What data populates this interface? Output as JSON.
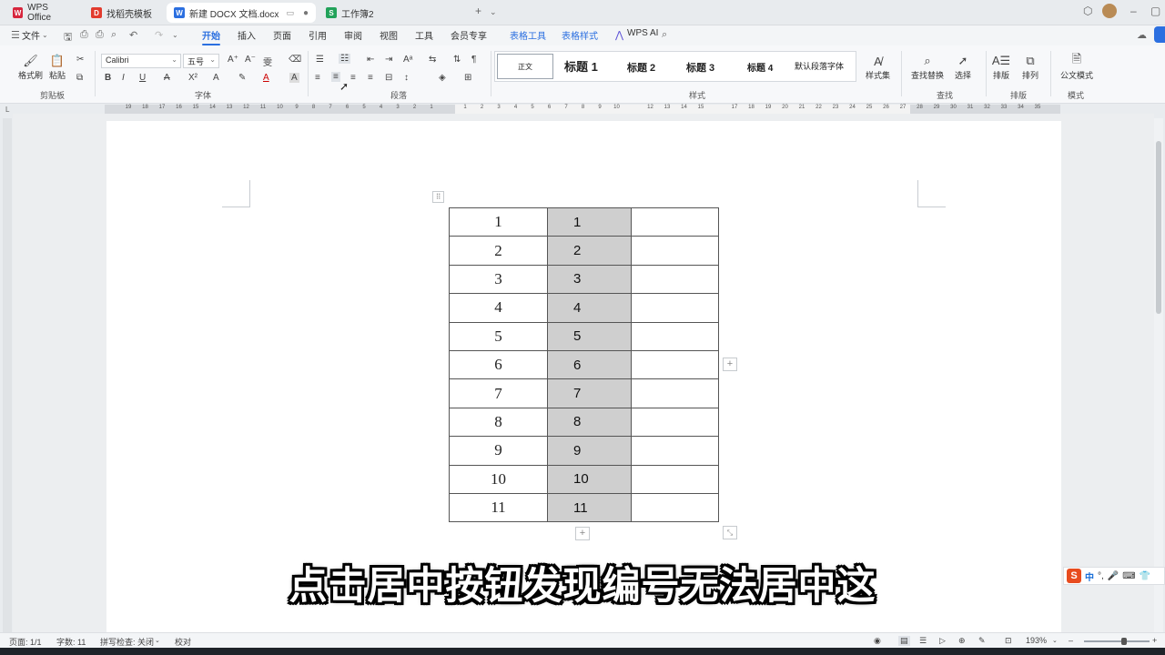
{
  "tabs": [
    {
      "label": "WPS Office",
      "icon": "wps-logo-icon",
      "color": "#d7263d"
    },
    {
      "label": "找稻壳模板",
      "icon": "docer-icon",
      "color": "#e23b2e"
    },
    {
      "label": "新建 DOCX 文档.docx",
      "icon": "word-doc-icon",
      "color": "#2b6fe0"
    },
    {
      "label": "工作簿2",
      "icon": "sheet-icon",
      "color": "#22a25a"
    }
  ],
  "menu": {
    "file": "文件",
    "items": [
      "开始",
      "插入",
      "页面",
      "引用",
      "审阅",
      "视图",
      "工具",
      "会员专享"
    ],
    "context": [
      "表格工具",
      "表格样式"
    ],
    "ai": "WPS AI"
  },
  "ribbon": {
    "clipboard": {
      "format_painter": "格式刷",
      "paste": "粘贴",
      "group": "剪贴板"
    },
    "font": {
      "name": "Calibri",
      "size": "五号",
      "group": "字体"
    },
    "paragraph": {
      "group": "段落"
    },
    "styles": {
      "items": [
        "正文",
        "标题 1",
        "标题 2",
        "标题 3",
        "标题 4",
        "默认段落字体"
      ],
      "set": "样式集",
      "group": "样式"
    },
    "find": {
      "find_replace": "查找替换",
      "select": "选择",
      "group": "查找"
    },
    "arrange": {
      "layout": "排版",
      "order": "排列",
      "group": "排版"
    },
    "mode": {
      "official": "公文模式",
      "group": "模式"
    }
  },
  "ruler": {
    "left_numbers": [
      "19",
      "18",
      "17",
      "16",
      "15",
      "14",
      "13",
      "12",
      "11",
      "10",
      "9",
      "8",
      "7",
      "6",
      "5",
      "4",
      "3",
      "2",
      "1"
    ],
    "right_numbers": [
      "1",
      "2",
      "3",
      "4",
      "5",
      "6",
      "7",
      "8",
      "9",
      "10",
      "12",
      "13",
      "14",
      "15",
      "17",
      "18",
      "19",
      "20",
      "21",
      "22",
      "23",
      "24",
      "25",
      "26",
      "27",
      "28",
      "29",
      "30",
      "31",
      "32",
      "33",
      "34",
      "35"
    ]
  },
  "table": {
    "rows": [
      [
        "1",
        "1",
        ""
      ],
      [
        "2",
        "2",
        ""
      ],
      [
        "3",
        "3",
        ""
      ],
      [
        "4",
        "4",
        ""
      ],
      [
        "5",
        "5",
        ""
      ],
      [
        "6",
        "6",
        ""
      ],
      [
        "7",
        "7",
        ""
      ],
      [
        "8",
        "8",
        ""
      ],
      [
        "9",
        "9",
        ""
      ],
      [
        "10",
        "10",
        ""
      ],
      [
        "11",
        "11",
        ""
      ]
    ],
    "shaded_color": "#cfcfcf"
  },
  "subtitle": "点击居中按钮发现编号无法居中这",
  "ime": {
    "lang": "中"
  },
  "status": {
    "page": "页面: 1/1",
    "words": "字数: 11",
    "spell": "拼写检查: 关闭",
    "proof": "校对",
    "zoom": "193%"
  },
  "colors": {
    "accent": "#2b6fe0",
    "page": "#ffffff"
  }
}
